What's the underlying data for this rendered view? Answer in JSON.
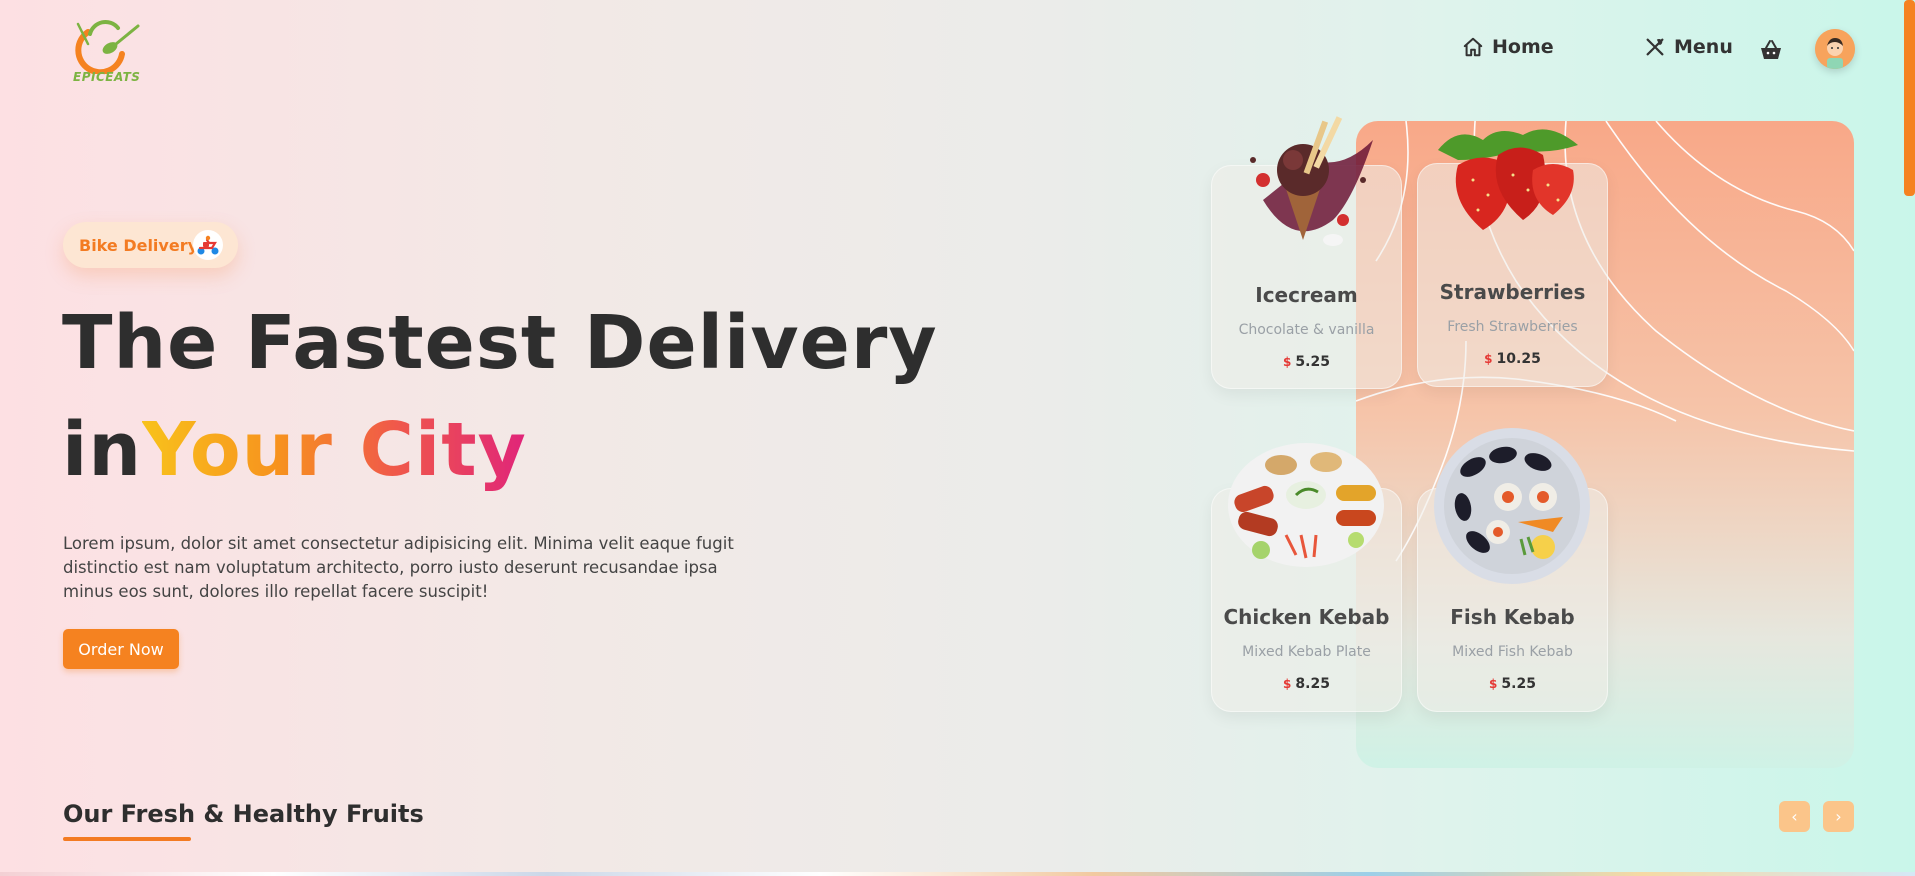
{
  "header": {
    "logo_text": "EPICEATS",
    "nav": [
      {
        "label": "Home",
        "icon": "home-icon"
      },
      {
        "label": "Menu",
        "icon": "utensils-icon"
      }
    ],
    "cart_icon": "basket-icon",
    "avatar_icon": "avatar"
  },
  "hero": {
    "badge_label": "Bike Delivery",
    "badge_icon": "scooter-icon",
    "title_line1": "The Fastest Delivery",
    "title_line2_prefix": "in",
    "title_line2_highlight": "Your City",
    "description": "Lorem ipsum, dolor sit amet consectetur adipisicing elit. Minima velit eaque fugit distinctio est nam voluptatum architecto, porro iusto deserunt recusandae ipsa minus eos sunt, dolores illo repellat facere suscipit!",
    "cta_label": "Order Now"
  },
  "cards": [
    {
      "title": "Icecream",
      "subtitle": "Chocolate & vanilla",
      "currency": "$",
      "price": "5.25"
    },
    {
      "title": "Strawberries",
      "subtitle": "Fresh Strawberries",
      "currency": "$",
      "price": "10.25"
    },
    {
      "title": "Chicken Kebab",
      "subtitle": "Mixed Kebab Plate",
      "currency": "$",
      "price": "8.25"
    },
    {
      "title": "Fish Kebab",
      "subtitle": "Mixed Fish Kebab",
      "currency": "$",
      "price": "5.25"
    }
  ],
  "section": {
    "title": "Our Fresh & Healthy Fruits",
    "prev_label": "‹",
    "next_label": "›"
  },
  "colors": {
    "accent": "#f58220",
    "price_currency": "#e53935",
    "logo_green": "#7cb342"
  }
}
